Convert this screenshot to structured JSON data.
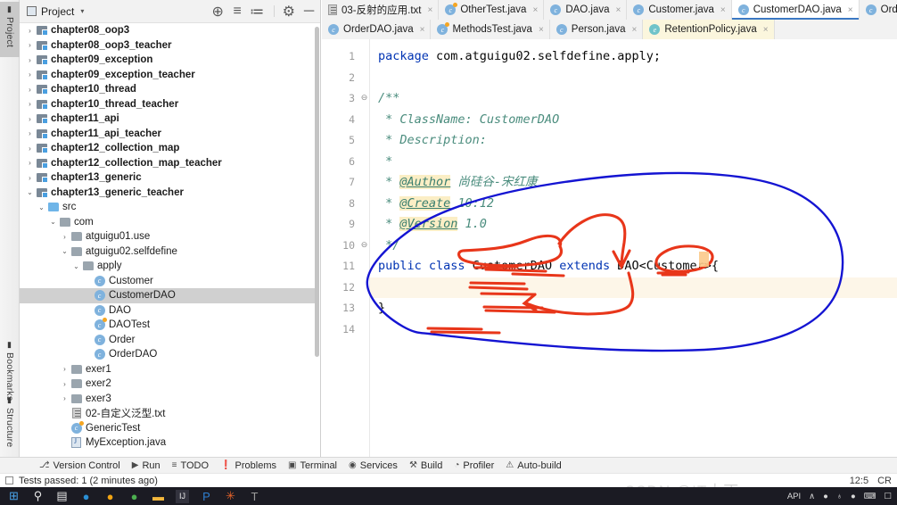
{
  "rail": {
    "top_items": [
      {
        "label": "Project",
        "icon": "folder-icon",
        "selected": true
      }
    ],
    "bottom_items": [
      {
        "label": "Bookmarks",
        "icon": "bookmark-icon",
        "selected": false
      },
      {
        "label": "Structure",
        "icon": "structure-icon",
        "selected": false
      }
    ]
  },
  "project_panel": {
    "title": "Project",
    "caret": "▾",
    "tools": [
      {
        "name": "locate-icon",
        "glyph": "⊕"
      },
      {
        "name": "expand-all-icon",
        "glyph": "≡"
      },
      {
        "name": "collapse-all-icon",
        "glyph": "≔"
      },
      {
        "name": "settings-gear-icon",
        "glyph": "⚙"
      },
      {
        "name": "hide-panel-icon",
        "glyph": "─"
      }
    ],
    "tree": [
      {
        "label": "chapter08_oop3",
        "indent": 0,
        "arrow": "›",
        "icon": "module-icon",
        "bold": true,
        "selected": false
      },
      {
        "label": "chapter08_oop3_teacher",
        "indent": 0,
        "arrow": "›",
        "icon": "module-icon",
        "bold": true,
        "selected": false
      },
      {
        "label": "chapter09_exception",
        "indent": 0,
        "arrow": "›",
        "icon": "module-icon",
        "bold": true,
        "selected": false
      },
      {
        "label": "chapter09_exception_teacher",
        "indent": 0,
        "arrow": "›",
        "icon": "module-icon",
        "bold": true,
        "selected": false
      },
      {
        "label": "chapter10_thread",
        "indent": 0,
        "arrow": "›",
        "icon": "module-icon",
        "bold": true,
        "selected": false
      },
      {
        "label": "chapter10_thread_teacher",
        "indent": 0,
        "arrow": "›",
        "icon": "module-icon",
        "bold": true,
        "selected": false
      },
      {
        "label": "chapter11_api",
        "indent": 0,
        "arrow": "›",
        "icon": "module-icon",
        "bold": true,
        "selected": false
      },
      {
        "label": "chapter11_api_teacher",
        "indent": 0,
        "arrow": "›",
        "icon": "module-icon",
        "bold": true,
        "selected": false
      },
      {
        "label": "chapter12_collection_map",
        "indent": 0,
        "arrow": "›",
        "icon": "module-icon",
        "bold": true,
        "selected": false
      },
      {
        "label": "chapter12_collection_map_teacher",
        "indent": 0,
        "arrow": "›",
        "icon": "module-icon",
        "bold": true,
        "selected": false
      },
      {
        "label": "chapter13_generic",
        "indent": 0,
        "arrow": "›",
        "icon": "module-icon",
        "bold": true,
        "selected": false
      },
      {
        "label": "chapter13_generic_teacher",
        "indent": 0,
        "arrow": "⌄",
        "icon": "module-icon",
        "bold": true,
        "selected": false
      },
      {
        "label": "src",
        "indent": 1,
        "arrow": "⌄",
        "icon": "source-folder-icon",
        "bold": false,
        "selected": false
      },
      {
        "label": "com",
        "indent": 2,
        "arrow": "⌄",
        "icon": "package-icon",
        "bold": false,
        "selected": false
      },
      {
        "label": "atguigu01.use",
        "indent": 3,
        "arrow": "›",
        "icon": "package-icon",
        "bold": false,
        "selected": false
      },
      {
        "label": "atguigu02.selfdefine",
        "indent": 3,
        "arrow": "⌄",
        "icon": "package-icon",
        "bold": false,
        "selected": false
      },
      {
        "label": "apply",
        "indent": 4,
        "arrow": "⌄",
        "icon": "package-icon",
        "bold": false,
        "selected": false
      },
      {
        "label": "Customer",
        "indent": 5,
        "arrow": "",
        "icon": "java-class-icon",
        "bold": false,
        "selected": false
      },
      {
        "label": "CustomerDAO",
        "indent": 5,
        "arrow": "",
        "icon": "java-class-icon",
        "bold": false,
        "selected": true
      },
      {
        "label": "DAO",
        "indent": 5,
        "arrow": "",
        "icon": "java-class-icon",
        "bold": false,
        "selected": false
      },
      {
        "label": "DAOTest",
        "indent": 5,
        "arrow": "",
        "icon": "java-runnable-class-icon",
        "bold": false,
        "selected": false
      },
      {
        "label": "Order",
        "indent": 5,
        "arrow": "",
        "icon": "java-class-icon",
        "bold": false,
        "selected": false
      },
      {
        "label": "OrderDAO",
        "indent": 5,
        "arrow": "",
        "icon": "java-class-icon",
        "bold": false,
        "selected": false
      },
      {
        "label": "exer1",
        "indent": 3,
        "arrow": "›",
        "icon": "package-icon",
        "bold": false,
        "selected": false
      },
      {
        "label": "exer2",
        "indent": 3,
        "arrow": "›",
        "icon": "package-icon",
        "bold": false,
        "selected": false
      },
      {
        "label": "exer3",
        "indent": 3,
        "arrow": "›",
        "icon": "package-icon",
        "bold": false,
        "selected": false
      },
      {
        "label": "02-自定义泛型.txt",
        "indent": 3,
        "arrow": "",
        "icon": "text-file-icon",
        "bold": false,
        "selected": false
      },
      {
        "label": "GenericTest",
        "indent": 3,
        "arrow": "",
        "icon": "java-runnable-class-icon",
        "bold": false,
        "selected": false
      },
      {
        "label": "MyException.java",
        "indent": 3,
        "arrow": "",
        "icon": "java-file-icon",
        "bold": false,
        "selected": false
      }
    ]
  },
  "editor": {
    "tabs_row1": [
      {
        "label": "03-反射的应用.txt",
        "icon": "text-file-icon",
        "active": false,
        "tinted": false,
        "closable": true
      },
      {
        "label": "OtherTest.java",
        "icon": "java-runnable-class-icon",
        "active": false,
        "tinted": false,
        "closable": true
      },
      {
        "label": "DAO.java",
        "icon": "java-class-icon",
        "active": false,
        "tinted": false,
        "closable": true
      },
      {
        "label": "Customer.java",
        "icon": "java-class-icon",
        "active": false,
        "tinted": false,
        "closable": true
      },
      {
        "label": "CustomerDAO.java",
        "icon": "java-class-icon",
        "active": true,
        "tinted": false,
        "closable": true
      },
      {
        "label": "Order.java",
        "icon": "java-class-icon",
        "active": false,
        "tinted": false,
        "closable": true
      }
    ],
    "tabs_row2": [
      {
        "label": "OrderDAO.java",
        "icon": "java-class-icon",
        "active": false,
        "tinted": false,
        "closable": true
      },
      {
        "label": "MethodsTest.java",
        "icon": "java-runnable-class-icon",
        "active": false,
        "tinted": false,
        "closable": true
      },
      {
        "label": "Person.java",
        "icon": "java-class-icon",
        "active": false,
        "tinted": false,
        "closable": true
      },
      {
        "label": "RetentionPolicy.java",
        "icon": "java-enum-icon",
        "active": false,
        "tinted": true,
        "closable": true
      }
    ],
    "close_glyph": "×",
    "line_numbers": [
      "1",
      "2",
      "3",
      "4",
      "5",
      "6",
      "7",
      "8",
      "9",
      "10",
      "11",
      "12",
      "13",
      "14"
    ],
    "current_line": 12,
    "fold_markers": [
      {
        "line": 3,
        "glyph": "⊖"
      },
      {
        "line": 10,
        "glyph": "⊖"
      }
    ],
    "code": [
      {
        "line": 1,
        "tokens": [
          {
            "t": "package",
            "c": "k"
          },
          {
            "t": " com.atguigu02.selfdefine.apply;",
            "c": "plain"
          }
        ]
      },
      {
        "line": 2,
        "tokens": []
      },
      {
        "line": 3,
        "tokens": [
          {
            "t": "/**",
            "c": "cmt"
          }
        ]
      },
      {
        "line": 4,
        "tokens": [
          {
            "t": " * ClassName: CustomerDAO",
            "c": "cmt"
          }
        ]
      },
      {
        "line": 5,
        "tokens": [
          {
            "t": " * Description:",
            "c": "cmt"
          }
        ]
      },
      {
        "line": 6,
        "tokens": [
          {
            "t": " *",
            "c": "cmt"
          }
        ]
      },
      {
        "line": 7,
        "tokens": [
          {
            "t": " * ",
            "c": "cmt"
          },
          {
            "t": "@Author",
            "c": "tag"
          },
          {
            "t": " 尚硅谷-宋红康",
            "c": "cmt"
          }
        ]
      },
      {
        "line": 8,
        "tokens": [
          {
            "t": " * ",
            "c": "cmt"
          },
          {
            "t": "@Create",
            "c": "tag"
          },
          {
            "t": " 10:12",
            "c": "cmt"
          }
        ]
      },
      {
        "line": 9,
        "tokens": [
          {
            "t": " * ",
            "c": "cmt"
          },
          {
            "t": "@Version",
            "c": "tag"
          },
          {
            "t": " 1.0",
            "c": "cmt"
          }
        ]
      },
      {
        "line": 10,
        "tokens": [
          {
            "t": " */",
            "c": "cmt"
          }
        ]
      },
      {
        "line": 11,
        "tokens": [
          {
            "t": "public class ",
            "c": "k"
          },
          {
            "t": "CustomerDAO ",
            "c": "plain"
          },
          {
            "t": "extends ",
            "c": "k"
          },
          {
            "t": "DAO<Customer>{",
            "c": "plain"
          }
        ]
      },
      {
        "line": 12,
        "tokens": []
      },
      {
        "line": 13,
        "tokens": [
          {
            "t": "}",
            "c": "plain"
          }
        ]
      },
      {
        "line": 14,
        "tokens": []
      }
    ]
  },
  "bottom_bar": {
    "items": [
      {
        "label": "Version Control",
        "icon": "branch-icon",
        "glyph": "⎇"
      },
      {
        "label": "Run",
        "icon": "run-play-icon",
        "glyph": "▶"
      },
      {
        "label": "TODO",
        "icon": "todo-list-icon",
        "glyph": "≡"
      },
      {
        "label": "Problems",
        "icon": "problems-warning-icon",
        "glyph": "❗"
      },
      {
        "label": "Terminal",
        "icon": "terminal-icon",
        "glyph": "▣"
      },
      {
        "label": "Services",
        "icon": "services-icon",
        "glyph": "◉"
      },
      {
        "label": "Build",
        "icon": "build-hammer-icon",
        "glyph": "⚒"
      },
      {
        "label": "Profiler",
        "icon": "profiler-icon",
        "glyph": "◔"
      },
      {
        "label": "Auto-build",
        "icon": "auto-build-warning-icon",
        "glyph": "⚠"
      }
    ]
  },
  "status_bar": {
    "message": "Tests passed: 1 (2 minutes ago)",
    "caret_position": "12:5",
    "line_separator": "CR"
  },
  "taskbar": {
    "icons": [
      {
        "name": "windows-start-icon",
        "glyph": "⊞",
        "color": "#4aa3e8",
        "active": false
      },
      {
        "name": "search-icon",
        "glyph": "⚲",
        "color": "#e8e8e8",
        "active": false
      },
      {
        "name": "task-view-icon",
        "glyph": "▤",
        "color": "#e8e8e8",
        "active": false
      },
      {
        "name": "microsoft-edge-icon",
        "glyph": "●",
        "color": "#2a8fd4",
        "active": false
      },
      {
        "name": "chrome-icon",
        "glyph": "●",
        "color": "#f2a413",
        "active": false
      },
      {
        "name": "chrome-canary-icon",
        "glyph": "●",
        "color": "#4caf50",
        "active": false
      },
      {
        "name": "file-explorer-icon",
        "glyph": "▬",
        "color": "#f3b73c",
        "active": false
      },
      {
        "name": "intellij-idea-icon",
        "glyph": "IJ",
        "color": "#e8e8e8",
        "active": true
      },
      {
        "name": "powerpoint-icon",
        "glyph": "P",
        "color": "#2f7fd1",
        "active": false
      },
      {
        "name": "app-orange-icon",
        "glyph": "✳",
        "color": "#e8642a",
        "active": false
      },
      {
        "name": "app-gray-icon",
        "glyph": "T",
        "color": "#9a9a9a",
        "active": false
      }
    ],
    "tray": [
      {
        "name": "api-label",
        "glyph": "API"
      },
      {
        "name": "tray-chevron-up-icon",
        "glyph": "∧"
      },
      {
        "name": "tray-pig-icon",
        "glyph": "●"
      },
      {
        "name": "tray-mic-icon",
        "glyph": "♁"
      },
      {
        "name": "tray-pot-icon",
        "glyph": "●"
      },
      {
        "name": "tray-ime-icon",
        "glyph": "⌨"
      },
      {
        "name": "tray-monitor-icon",
        "glyph": "☐"
      }
    ]
  },
  "watermark": {
    "text": "CSDN @IT小丁"
  },
  "annotations": {
    "blue_color": "#1414d2",
    "red_color": "#e8361a",
    "cursor_color": "#fbc98a",
    "shapes": [
      {
        "name": "blue-enclosing-loop",
        "color": "#1414d2"
      },
      {
        "name": "red-ellipse-customerdao",
        "color": "#e8361a"
      },
      {
        "name": "red-ellipse-customer-generic",
        "color": "#e8361a"
      },
      {
        "name": "red-arrow-down",
        "color": "#e8361a"
      },
      {
        "name": "red-arrow-left",
        "color": "#e8361a"
      },
      {
        "name": "red-underline-strokes",
        "color": "#e8361a"
      }
    ]
  },
  "colors": {
    "accent": "#3b78c3",
    "selection": "#d0d0d0",
    "current_line": "#fdf6e8",
    "panel_bg": "#f2f2f2",
    "editor_bg": "#ffffff",
    "keyword": "#0033b3",
    "comment": "#4a8c7d"
  }
}
